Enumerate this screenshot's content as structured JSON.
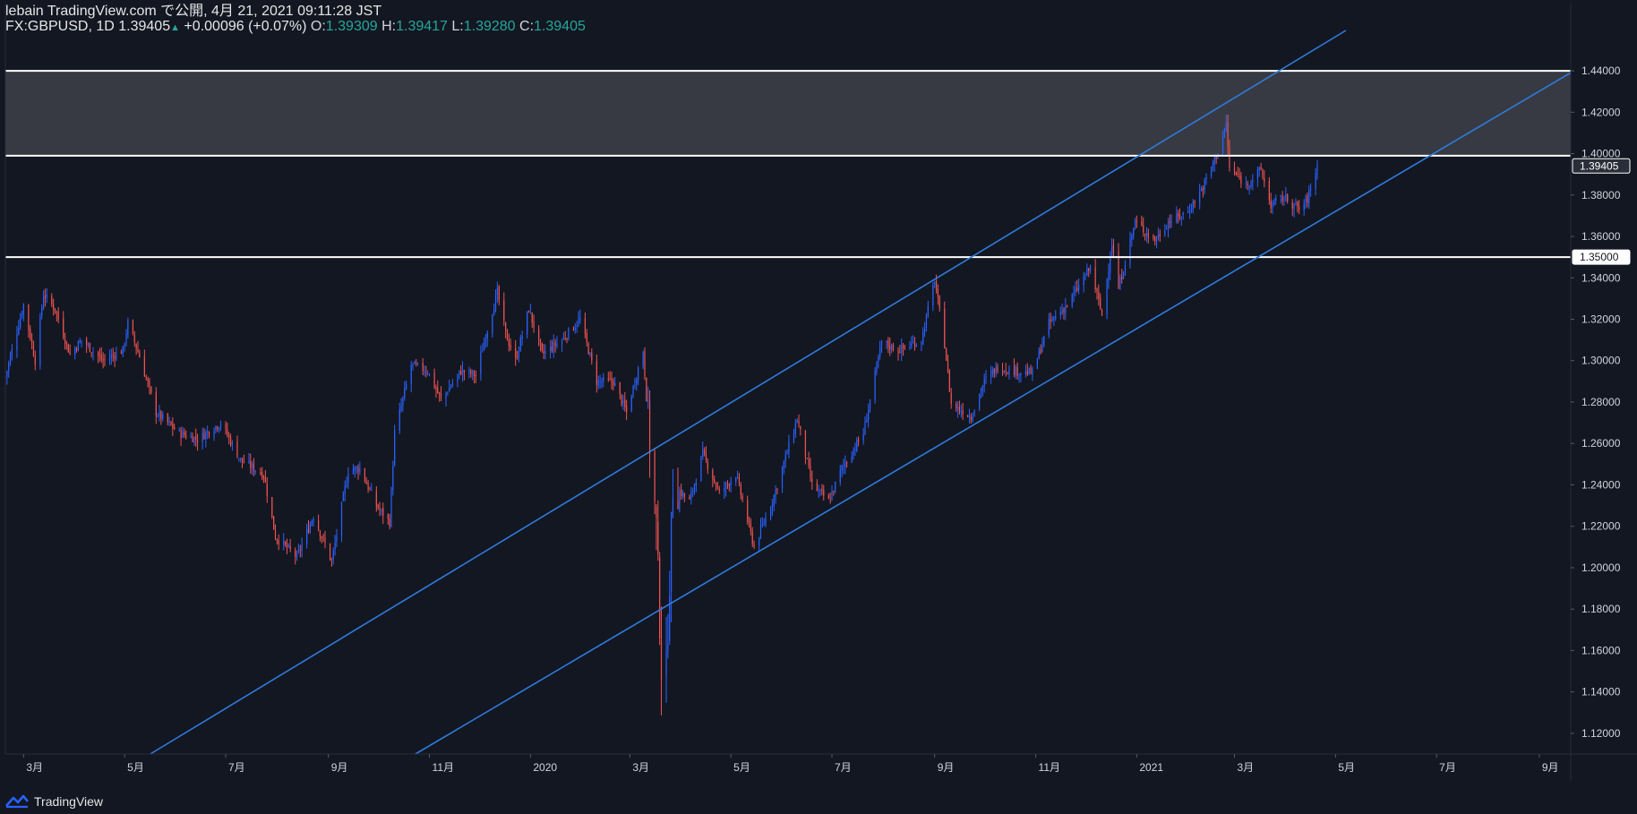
{
  "header": {
    "publisher": "lebain TradingView.com で公開, 4月 21, 2021 09:11:28 JST",
    "symbol": "FX:GBPUSD, 1D",
    "last": "1.39405",
    "change_arrow": "▲",
    "change": "+0.00096 (+0.07%)",
    "o_label": "O:",
    "o_value": "1.39309",
    "h_label": "H:",
    "h_value": "1.39417",
    "l_label": "L:",
    "l_value": "1.39280",
    "c_label": "C:",
    "c_value": "1.39405"
  },
  "footer": {
    "brand": "TradingView",
    "logo_icon": "tradingview-logo-icon"
  },
  "colors": {
    "background": "#131722",
    "up": "#2962ff",
    "down": "#ef5350",
    "channel": "#2f7bdc",
    "level": "#ffffff",
    "zone": "#393c44"
  },
  "chart_data": {
    "type": "candlestick",
    "symbol": "GBPUSD",
    "timeframe": "1D",
    "x_range": [
      "2019-02-18",
      "2021-09-20"
    ],
    "ylim": [
      1.11,
      1.4595
    ],
    "y_ticks": [
      "1.12000",
      "1.14000",
      "1.16000",
      "1.18000",
      "1.20000",
      "1.22000",
      "1.24000",
      "1.26000",
      "1.28000",
      "1.30000",
      "1.32000",
      "1.34000",
      "1.36000",
      "1.38000",
      "1.40000",
      "1.42000",
      "1.44000"
    ],
    "x_ticks": [
      {
        "date": "2019-03-01",
        "label": "3月"
      },
      {
        "date": "2019-05-01",
        "label": "5月"
      },
      {
        "date": "2019-07-01",
        "label": "7月"
      },
      {
        "date": "2019-09-01",
        "label": "9月"
      },
      {
        "date": "2019-11-01",
        "label": "11月"
      },
      {
        "date": "2020-01-01",
        "label": "2020"
      },
      {
        "date": "2020-03-01",
        "label": "3月"
      },
      {
        "date": "2020-05-01",
        "label": "5月"
      },
      {
        "date": "2020-07-01",
        "label": "7月"
      },
      {
        "date": "2020-09-01",
        "label": "9月"
      },
      {
        "date": "2020-11-01",
        "label": "11月"
      },
      {
        "date": "2021-01-01",
        "label": "2021"
      },
      {
        "date": "2021-03-01",
        "label": "3月"
      },
      {
        "date": "2021-05-01",
        "label": "5月"
      },
      {
        "date": "2021-07-01",
        "label": "7月"
      },
      {
        "date": "2021-09-01",
        "label": "9月"
      }
    ],
    "price_path": [
      [
        "2019-02-18",
        1.292
      ],
      [
        "2019-02-22",
        1.305
      ],
      [
        "2019-03-01",
        1.327
      ],
      [
        "2019-03-08",
        1.3
      ],
      [
        "2019-03-13",
        1.332
      ],
      [
        "2019-03-20",
        1.325
      ],
      [
        "2019-03-29",
        1.303
      ],
      [
        "2019-04-05",
        1.31
      ],
      [
        "2019-04-18",
        1.3
      ],
      [
        "2019-04-30",
        1.305
      ],
      [
        "2019-05-03",
        1.318
      ],
      [
        "2019-05-10",
        1.302
      ],
      [
        "2019-05-20",
        1.275
      ],
      [
        "2019-06-03",
        1.265
      ],
      [
        "2019-06-14",
        1.262
      ],
      [
        "2019-06-28",
        1.27
      ],
      [
        "2019-07-10",
        1.252
      ],
      [
        "2019-07-24",
        1.245
      ],
      [
        "2019-07-31",
        1.215
      ],
      [
        "2019-08-13",
        1.205
      ],
      [
        "2019-08-23",
        1.225
      ],
      [
        "2019-09-03",
        1.203
      ],
      [
        "2019-09-13",
        1.247
      ],
      [
        "2019-09-20",
        1.248
      ],
      [
        "2019-09-30",
        1.23
      ],
      [
        "2019-10-08",
        1.222
      ],
      [
        "2019-10-11",
        1.265
      ],
      [
        "2019-10-21",
        1.298
      ],
      [
        "2019-10-31",
        1.295
      ],
      [
        "2019-11-08",
        1.281
      ],
      [
        "2019-11-20",
        1.295
      ],
      [
        "2019-11-29",
        1.293
      ],
      [
        "2019-12-05",
        1.312
      ],
      [
        "2019-12-12",
        1.333
      ],
      [
        "2019-12-17",
        1.313
      ],
      [
        "2019-12-23",
        1.3
      ],
      [
        "2019-12-31",
        1.325
      ],
      [
        "2020-01-08",
        1.303
      ],
      [
        "2020-01-20",
        1.31
      ],
      [
        "2020-01-31",
        1.32
      ],
      [
        "2020-02-10",
        1.29
      ],
      [
        "2020-02-20",
        1.29
      ],
      [
        "2020-02-28",
        1.275
      ],
      [
        "2020-03-09",
        1.305
      ],
      [
        "2020-03-13",
        1.26
      ],
      [
        "2020-03-17",
        1.22
      ],
      [
        "2020-03-20",
        1.152
      ],
      [
        "2020-03-23",
        1.15
      ],
      [
        "2020-03-27",
        1.24
      ],
      [
        "2020-04-06",
        1.232
      ],
      [
        "2020-04-14",
        1.255
      ],
      [
        "2020-04-24",
        1.236
      ],
      [
        "2020-05-04",
        1.245
      ],
      [
        "2020-05-15",
        1.21
      ],
      [
        "2020-05-26",
        1.232
      ],
      [
        "2020-06-10",
        1.272
      ],
      [
        "2020-06-19",
        1.24
      ],
      [
        "2020-06-29",
        1.232
      ],
      [
        "2020-07-07",
        1.248
      ],
      [
        "2020-07-20",
        1.265
      ],
      [
        "2020-07-31",
        1.309
      ],
      [
        "2020-08-10",
        1.305
      ],
      [
        "2020-08-24",
        1.31
      ],
      [
        "2020-09-01",
        1.339
      ],
      [
        "2020-09-07",
        1.308
      ],
      [
        "2020-09-11",
        1.279
      ],
      [
        "2020-09-23",
        1.273
      ],
      [
        "2020-10-01",
        1.29
      ],
      [
        "2020-10-09",
        1.297
      ],
      [
        "2020-10-20",
        1.295
      ],
      [
        "2020-10-30",
        1.294
      ],
      [
        "2020-11-09",
        1.318
      ],
      [
        "2020-11-20",
        1.327
      ],
      [
        "2020-12-04",
        1.345
      ],
      [
        "2020-12-11",
        1.322
      ],
      [
        "2020-12-17",
        1.357
      ],
      [
        "2020-12-21",
        1.335
      ],
      [
        "2020-12-31",
        1.367
      ],
      [
        "2021-01-12",
        1.358
      ],
      [
        "2021-01-20",
        1.367
      ],
      [
        "2021-02-01",
        1.372
      ],
      [
        "2021-02-10",
        1.384
      ],
      [
        "2021-02-19",
        1.401
      ],
      [
        "2021-02-24",
        1.414
      ],
      [
        "2021-02-26",
        1.393
      ],
      [
        "2021-03-08",
        1.385
      ],
      [
        "2021-03-17",
        1.392
      ],
      [
        "2021-03-23",
        1.375
      ],
      [
        "2021-03-31",
        1.379
      ],
      [
        "2021-04-09",
        1.373
      ],
      [
        "2021-04-14",
        1.378
      ],
      [
        "2021-04-20",
        1.394
      ]
    ],
    "channel_lines": [
      {
        "from": [
          "2020-03-13",
          1.256
        ],
        "to": [
          "2021-02-25",
          1.425
        ]
      },
      {
        "from": [
          "2020-05-14",
          1.206
        ],
        "to": [
          "2020-12-31",
          1.315
        ]
      }
    ],
    "horizontal_levels": [
      1.44,
      1.399,
      1.35
    ],
    "zone": [
      1.399,
      1.44
    ],
    "price_tags": [
      {
        "price": 1.39405,
        "label": "1.39405"
      },
      {
        "price": 1.35,
        "label": "1.35000"
      }
    ]
  }
}
